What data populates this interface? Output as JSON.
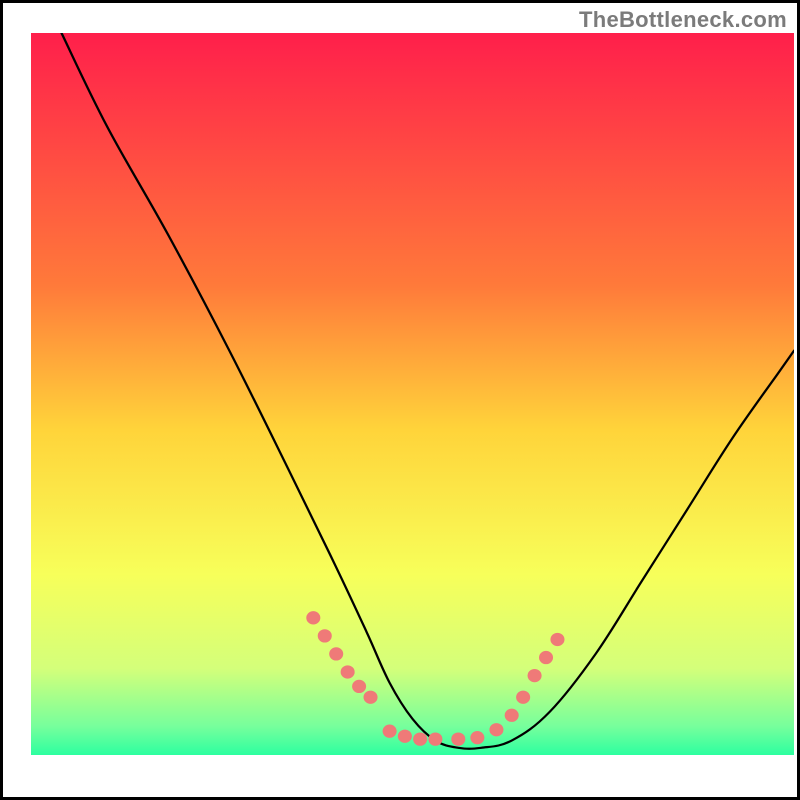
{
  "watermark": "TheBottleneck.com",
  "chart_data": {
    "type": "line",
    "title": "",
    "xlabel": "",
    "ylabel": "",
    "xlim": [
      0,
      100
    ],
    "ylim": [
      0,
      100
    ],
    "gradient_stops": [
      {
        "offset": 0,
        "color": "#ff1f4b"
      },
      {
        "offset": 35,
        "color": "#ff7a3a"
      },
      {
        "offset": 55,
        "color": "#ffd43a"
      },
      {
        "offset": 75,
        "color": "#f7ff5a"
      },
      {
        "offset": 88,
        "color": "#d4ff7a"
      },
      {
        "offset": 96,
        "color": "#77ff9c"
      },
      {
        "offset": 100,
        "color": "#2dffa0"
      }
    ],
    "series": [
      {
        "name": "bottleneck-curve",
        "x": [
          4,
          10,
          18,
          26,
          34,
          40,
          44,
          47,
          50,
          53,
          56,
          59,
          63,
          68,
          74,
          80,
          86,
          92,
          98,
          100
        ],
        "y": [
          100,
          87,
          72,
          56,
          39,
          26,
          17,
          10,
          5,
          2,
          1,
          1,
          2,
          6,
          14,
          24,
          34,
          44,
          53,
          56
        ]
      }
    ],
    "markers": [
      {
        "name": "highlight-dots",
        "color": "#ef7a78",
        "radius": 7,
        "x": [
          37,
          38.5,
          40,
          41.5,
          43,
          44.5,
          47,
          49,
          51,
          53,
          56,
          58.5,
          61,
          63,
          64.5,
          66,
          67.5,
          69
        ],
        "y": [
          19,
          16.5,
          14,
          11.5,
          9.5,
          8,
          3.3,
          2.6,
          2.2,
          2.2,
          2.2,
          2.4,
          3.5,
          5.5,
          8,
          11,
          13.5,
          16
        ]
      }
    ]
  }
}
